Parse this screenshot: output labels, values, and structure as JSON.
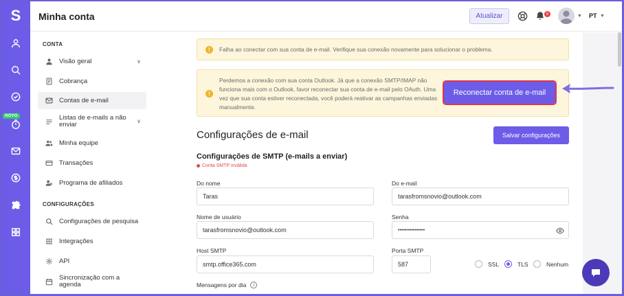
{
  "app": {
    "logo_letter": "S",
    "title": "Minha conta",
    "new_badge": "NOVO"
  },
  "topbar": {
    "update_label": "Atualizar",
    "notification_count": "5",
    "language": "PT"
  },
  "sidebar": {
    "section_account": "CONTA",
    "account_items": [
      {
        "label": "Visão geral",
        "icon": "user-icon"
      },
      {
        "label": "Cobrança",
        "icon": "document-icon"
      },
      {
        "label": "Contas de e-mail",
        "icon": "mail-icon"
      },
      {
        "label": "Listas de e-mails a não enviar",
        "icon": "list-icon"
      },
      {
        "label": "Minha equipe",
        "icon": "team-icon"
      },
      {
        "label": "Transações",
        "icon": "card-icon"
      },
      {
        "label": "Programa de afiliados",
        "icon": "affiliate-icon"
      }
    ],
    "section_settings": "CONFIGURAÇÕES",
    "settings_items": [
      {
        "label": "Configurações de pesquisa",
        "icon": "search-icon"
      },
      {
        "label": "Integrações",
        "icon": "grid-icon"
      },
      {
        "label": "API",
        "icon": "gear-icon"
      },
      {
        "label": "Sincronização com a agenda",
        "icon": "calendar-icon"
      }
    ]
  },
  "alerts": {
    "connection_failed": "Falha ao conectar com sua conta de e-mail. Verifique sua conexão novamente para solucionar o problema.",
    "connection_lost": "Perdemos a conexão com sua conta Outlook. Já que a conexão SMTP/IMAP não funciona mais com o Outlook, favor reconectar sua conta de e-mail pelo OAuth. Uma vez que sua conta estiver reconectada, você poderá reativar as campanhas enviadas manualmente.",
    "reconnect_label": "Reconectar conta de e-mail"
  },
  "settings": {
    "title": "Configurações de e-mail",
    "save_label": "Salvar configurações",
    "smtp_title": "Configurações de SMTP (e-mails a enviar)",
    "smtp_status": "Conta SMTP inválida",
    "from_name_label": "Do nome",
    "from_name_value": "Taras",
    "from_email_label": "Do e-mail",
    "from_email_value": "tarasfromsnovio@outlook.com",
    "username_label": "Nome de usuário",
    "username_value": "tarasfromsnovio@outlook.com",
    "password_label": "Senha",
    "password_value": "••••••••••••••••",
    "host_label": "Host SMTP",
    "host_value": "smtp.office365.com",
    "port_label": "Porta SMTP",
    "port_value": "587",
    "security_options": [
      "SSL",
      "TLS",
      "Nenhum"
    ],
    "security_selected": "TLS",
    "messages_per_day_label": "Mensagens por dia"
  },
  "colors": {
    "accent": "#6c5ce7",
    "warning_bg": "#fdf6dc",
    "error": "#e04a4a"
  }
}
